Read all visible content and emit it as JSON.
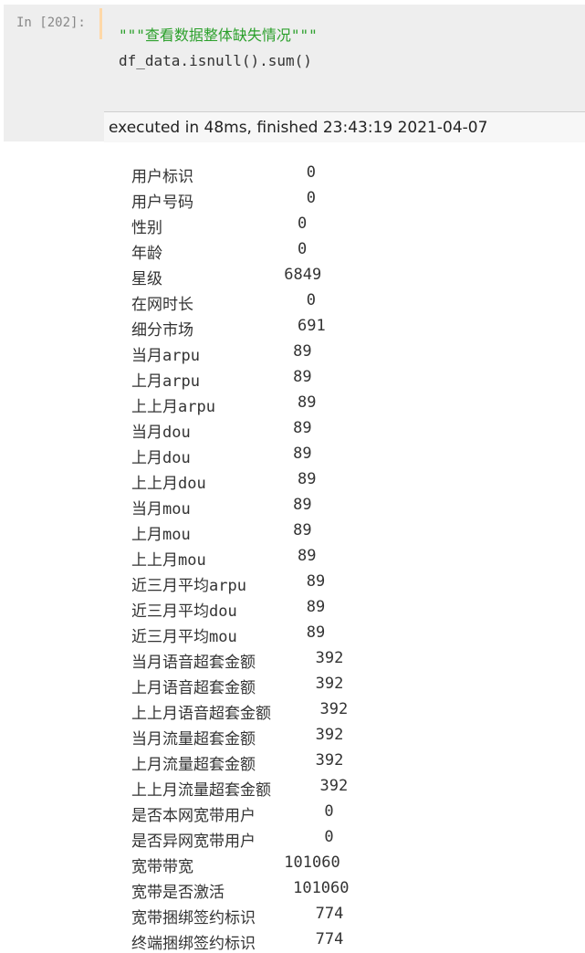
{
  "cell": {
    "prompt": "In [202]:",
    "code_line_1": "\"\"\"查看数据整体缺失情况\"\"\"",
    "code_line_2": "df_data.isnull().sum()",
    "exec_info": "executed in 48ms, finished 23:43:19 2021-04-07"
  },
  "output": {
    "rows": [
      {
        "name": "用户标识",
        "value": "0"
      },
      {
        "name": "用户号码",
        "value": "0"
      },
      {
        "name": "性别",
        "value": "0"
      },
      {
        "name": "年龄",
        "value": "0"
      },
      {
        "name": "星级",
        "value": "6849"
      },
      {
        "name": "在网时长",
        "value": "0"
      },
      {
        "name": "细分市场",
        "value": "691"
      },
      {
        "name": "当月arpu",
        "value": "89"
      },
      {
        "name": "上月arpu",
        "value": "89"
      },
      {
        "name": "上上月arpu",
        "value": "89"
      },
      {
        "name": "当月dou",
        "value": "89"
      },
      {
        "name": "上月dou",
        "value": "89"
      },
      {
        "name": "上上月dou",
        "value": "89"
      },
      {
        "name": "当月mou",
        "value": "89"
      },
      {
        "name": "上月mou",
        "value": "89"
      },
      {
        "name": "上上月mou",
        "value": "89"
      },
      {
        "name": "近三月平均arpu",
        "value": "89"
      },
      {
        "name": "近三月平均dou",
        "value": "89"
      },
      {
        "name": "近三月平均mou",
        "value": "89"
      },
      {
        "name": "当月语音超套金额",
        "value": "392"
      },
      {
        "name": "上月语音超套金额",
        "value": "392"
      },
      {
        "name": "上上月语音超套金额",
        "value": "392"
      },
      {
        "name": "当月流量超套金额",
        "value": "392"
      },
      {
        "name": "上月流量超套金额",
        "value": "392"
      },
      {
        "name": "上上月流量超套金额",
        "value": "392"
      },
      {
        "name": "是否本网宽带用户",
        "value": "0"
      },
      {
        "name": "是否异网宽带用户",
        "value": "0"
      },
      {
        "name": "宽带带宽",
        "value": "101060"
      },
      {
        "name": "宽带是否激活",
        "value": "101060"
      },
      {
        "name": "宽带捆绑签约标识",
        "value": "774"
      },
      {
        "name": "终端捆绑签约标识",
        "value": "774"
      }
    ]
  },
  "colors": {
    "cell_background": "#eeeeee",
    "docstring_green": "#2ca02c",
    "prompt_gray": "#888888"
  }
}
